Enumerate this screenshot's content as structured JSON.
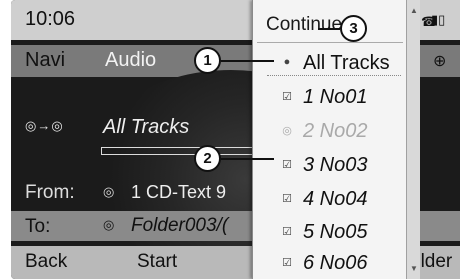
{
  "status_bar": {
    "time": "10:06",
    "icons": [
      "signal-bars-icon",
      "phone-handset-icon"
    ]
  },
  "main_menu": {
    "items": [
      "Navi",
      "Audio"
    ],
    "active": "Audio",
    "globe_icon": "globe-icon"
  },
  "player": {
    "source_icon": "cd-to-hdd-icon",
    "source_icon_glyph": "◎→◎",
    "title": "All Tracks",
    "progress": 1.0
  },
  "copy": {
    "from_label": "From:",
    "from_icon_glyph": "◎",
    "from_value": "1 CD-Text 9",
    "to_label": "To:",
    "to_icon_glyph": "◎",
    "to_value": "Folder003/("
  },
  "softkeys": {
    "back": "Back",
    "start": "Start",
    "folder": "older"
  },
  "menu": {
    "continue": "Continue",
    "items": [
      {
        "label": "All Tracks",
        "icon": "radio-dot-icon",
        "icon_glyph": "●",
        "state": "selected"
      },
      {
        "label": "1 No01",
        "icon": "checkbox-checked-icon",
        "icon_glyph": "☑",
        "state": "checked"
      },
      {
        "label": "2 No02",
        "icon": "hdd-icon",
        "icon_glyph": "◎",
        "state": "disabled"
      },
      {
        "label": "3 No03",
        "icon": "checkbox-checked-icon",
        "icon_glyph": "☑",
        "state": "checked"
      },
      {
        "label": "4 No04",
        "icon": "checkbox-checked-icon",
        "icon_glyph": "☑",
        "state": "checked"
      },
      {
        "label": "5 No05",
        "icon": "checkbox-checked-icon",
        "icon_glyph": "☑",
        "state": "checked"
      },
      {
        "label": "6 No06",
        "icon": "checkbox-checked-icon",
        "icon_glyph": "☑",
        "state": "checked"
      }
    ]
  },
  "callouts": [
    "1",
    "2",
    "3"
  ]
}
